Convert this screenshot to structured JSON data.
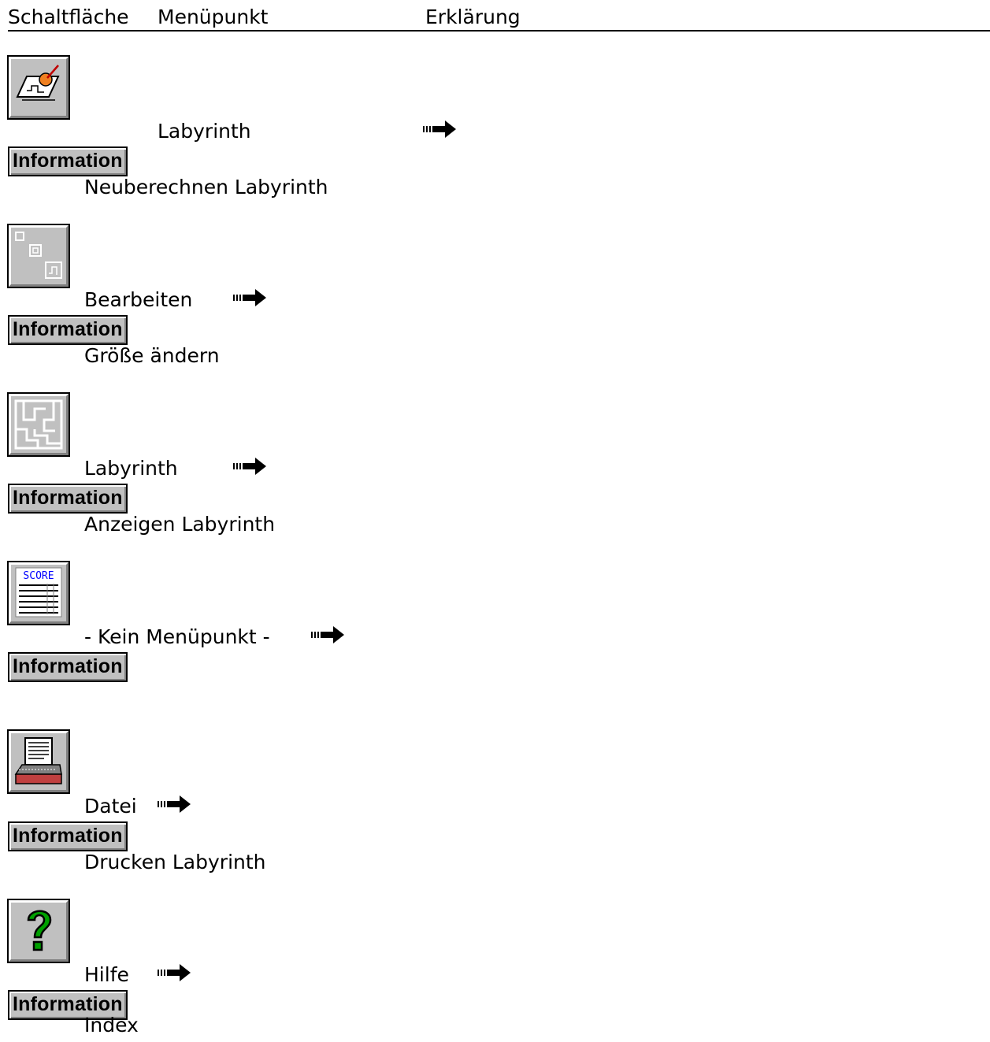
{
  "header": {
    "col_button": "Schaltfläche",
    "col_menu": "Menüpunkt",
    "col_explain": "Erklärung"
  },
  "rows": [
    {
      "icon": "edit-labyrinth-icon",
      "menu": "Labyrinth",
      "info": "Information",
      "command": "Neuberechnen Labyrinth"
    },
    {
      "icon": "resize-icon",
      "menu": "Bearbeiten",
      "info": "Information",
      "command": "Größe ändern"
    },
    {
      "icon": "maze-icon",
      "menu": "Labyrinth",
      "info": "Information",
      "command": "Anzeigen Labyrinth"
    },
    {
      "icon": "score-icon",
      "menu": "- Kein Menüpunkt -",
      "info": "Information",
      "command": ""
    },
    {
      "icon": "printer-icon",
      "menu": "Datei",
      "info": "Information",
      "command": "Drucken Labyrinth"
    },
    {
      "icon": "help-question-icon",
      "menu": "Hilfe",
      "info": "Information",
      "command": "Index"
    }
  ],
  "colors": {
    "button_face": "#c0c0c0",
    "help_green": "#00a000",
    "score_blue": "#0000ff",
    "printer_red": "#c04040"
  }
}
